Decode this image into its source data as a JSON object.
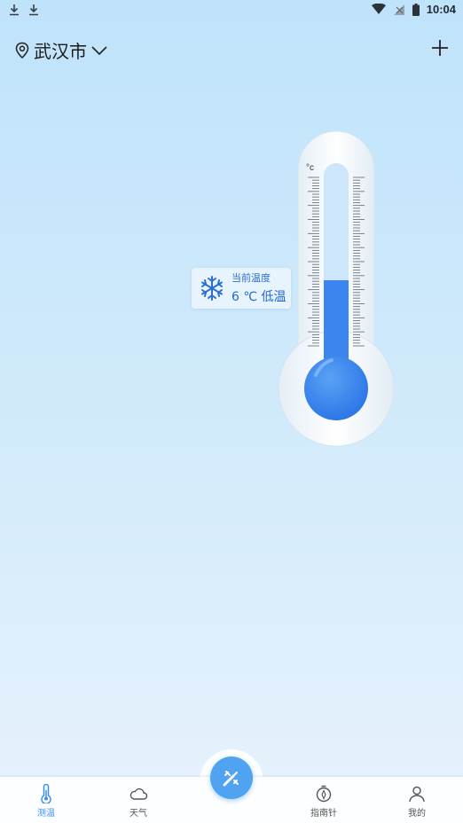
{
  "status_bar": {
    "time": "10:04"
  },
  "header": {
    "city": "武汉市"
  },
  "thermometer": {
    "unit_label": "°c",
    "fill_level": 0.45,
    "reading_title": "当前温度",
    "reading_value": "6 ℃ 低温"
  },
  "bottom_nav": {
    "items": [
      {
        "label": "测温",
        "icon": "thermometer-icon",
        "active": true
      },
      {
        "label": "天气",
        "icon": "cloud-icon",
        "active": false
      },
      {
        "label": "指南针",
        "icon": "compass-icon",
        "active": false
      },
      {
        "label": "我的",
        "icon": "profile-icon",
        "active": false
      }
    ],
    "fab_icon": "edit-tools-icon"
  },
  "colors": {
    "accent": "#3d8ef2",
    "mercury": "#3a86ee",
    "background_top": "#bfe3fb",
    "background_bottom": "#e8f2fc"
  }
}
